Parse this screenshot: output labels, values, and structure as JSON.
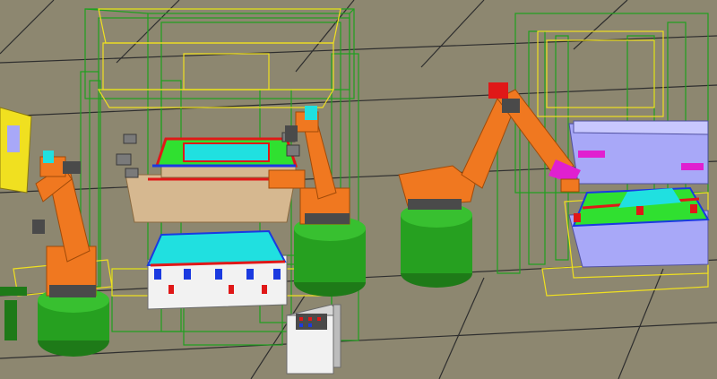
{
  "viewport": {
    "background": "#8d8770",
    "floor_grid_color": "#2e2e2e"
  },
  "colors": {
    "robot_orange": "#f07820",
    "robot_dark": "#4a4a4a",
    "pedestal_green": "#26a020",
    "wireframe_green": "#1ea01e",
    "wireframe_yellow": "#f0e020",
    "tool_red": "#e01818",
    "tool_blue": "#1a3ae0",
    "tool_cyan": "#20e0e0",
    "tool_magenta": "#e020d0",
    "die_lavender": "#a8a8f8",
    "die_white": "#f2f2f2",
    "die_tan": "#d6b890",
    "panel_green": "#30e030"
  },
  "objects": [
    {
      "id": "robot-left",
      "kind": "industrial-robot"
    },
    {
      "id": "robot-center",
      "kind": "industrial-robot"
    },
    {
      "id": "robot-right",
      "kind": "industrial-robot"
    },
    {
      "id": "press-left",
      "kind": "stamping-press-wireframe"
    },
    {
      "id": "press-right",
      "kind": "stamping-press-wireframe"
    },
    {
      "id": "control-cabinet",
      "kind": "control-cabinet"
    }
  ]
}
